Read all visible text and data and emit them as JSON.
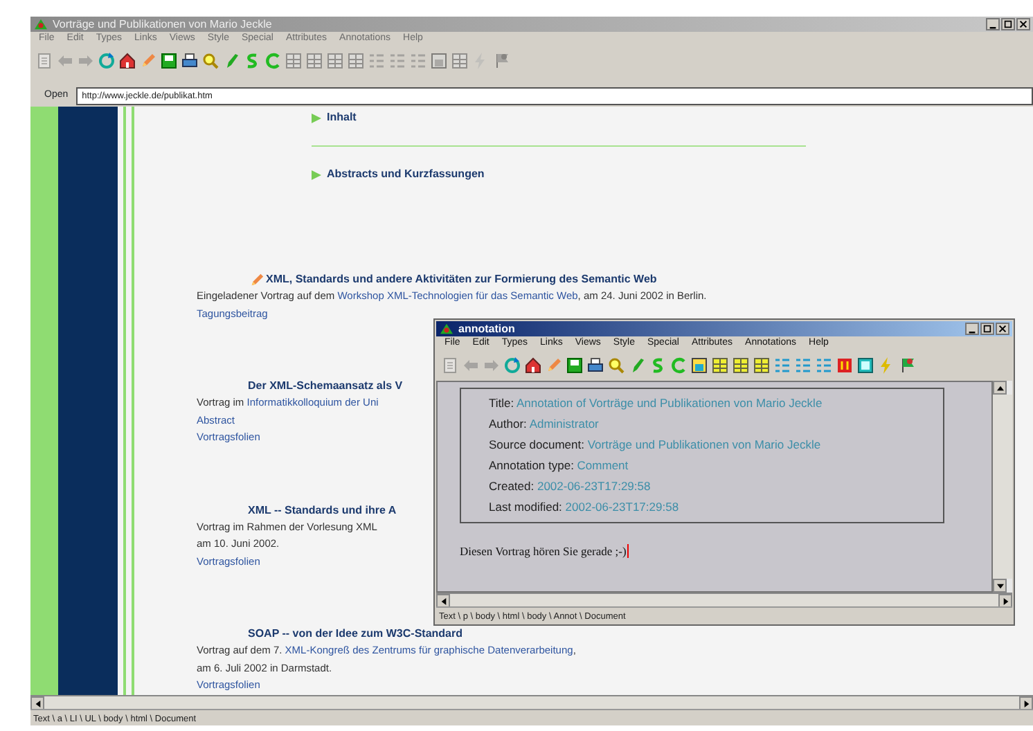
{
  "window": {
    "title": "Vorträge und Publikationen von Mario Jeckle"
  },
  "menu": [
    "File",
    "Edit",
    "Types",
    "Links",
    "Views",
    "Style",
    "Special",
    "Attributes",
    "Annotations",
    "Help"
  ],
  "address": {
    "label": "Open",
    "value": "http://www.jeckle.de/publikat.htm"
  },
  "page": {
    "nav_links": [
      "Inhalt",
      "Abstracts und Kurzfassungen"
    ],
    "entries": [
      {
        "title": "XML, Standards und andere Aktivitäten zur Formierung des Semantic Web",
        "annotated": true,
        "lines": [
          [
            {
              "kind": "text",
              "text": "Eingeladener Vortrag auf dem "
            },
            {
              "kind": "link",
              "text": "Workshop XML-Technologien für das Semantic Web"
            },
            {
              "kind": "text",
              "text": ", am 24. Juni 2002 in Berlin."
            }
          ],
          [
            {
              "kind": "link",
              "text": "Tagungsbeitrag"
            }
          ]
        ]
      },
      {
        "title": "Der XML-Schemaansatz als V",
        "annotated": false,
        "lines": [
          [
            {
              "kind": "text",
              "text": "Vortrag im "
            },
            {
              "kind": "link",
              "text": "Informatikkolloquium der Uni"
            }
          ],
          [
            {
              "kind": "link",
              "text": "Abstract"
            }
          ],
          [
            {
              "kind": "link",
              "text": "Vortragsfolien"
            }
          ]
        ]
      },
      {
        "title": "XML -- Standards und ihre A",
        "annotated": false,
        "lines": [
          [
            {
              "kind": "text",
              "text": "Vortrag im Rahmen der Vorlesung XML"
            }
          ],
          [
            {
              "kind": "text",
              "text": "am 10. Juni 2002."
            }
          ],
          [
            {
              "kind": "link",
              "text": "Vortragsfolien"
            }
          ]
        ]
      },
      {
        "title": "SOAP -- von der Idee zum W3C-Standard",
        "annotated": false,
        "lines": [
          [
            {
              "kind": "text",
              "text": "Vortrag auf dem 7. "
            },
            {
              "kind": "link",
              "text": "XML-Kongreß des Zentrums für graphische Datenverarbeitung"
            },
            {
              "kind": "text",
              "text": ","
            }
          ],
          [
            {
              "kind": "text",
              "text": "am 6. Juli 2002 in Darmstadt."
            }
          ],
          [
            {
              "kind": "link",
              "text": "Vortragsfolien"
            }
          ]
        ]
      }
    ]
  },
  "status_bar": "Text \\ a \\ LI \\ UL \\ body \\ html \\ Document",
  "annotation_window": {
    "title": "annotation",
    "menu": [
      "File",
      "Edit",
      "Types",
      "Links",
      "Views",
      "Style",
      "Special",
      "Attributes",
      "Annotations",
      "Help"
    ],
    "fields": [
      {
        "label": "Title:",
        "value": "Annotation of Vorträge und Publikationen von Mario Jeckle"
      },
      {
        "label": "Author:",
        "value": "Administrator"
      },
      {
        "label": "Source document:",
        "value": "Vorträge und Publikationen von Mario Jeckle"
      },
      {
        "label": "Annotation type:",
        "value": "Comment"
      },
      {
        "label": "Created:",
        "value": "2002-06-23T17:29:58"
      },
      {
        "label": "Last modified:",
        "value": "2002-06-23T17:29:58"
      }
    ],
    "body": "Diesen Vortrag hören Sie gerade ;-)",
    "cursor": true,
    "status_bar": "Text \\ p \\ body \\ html \\ body \\ Annot \\ Document"
  }
}
